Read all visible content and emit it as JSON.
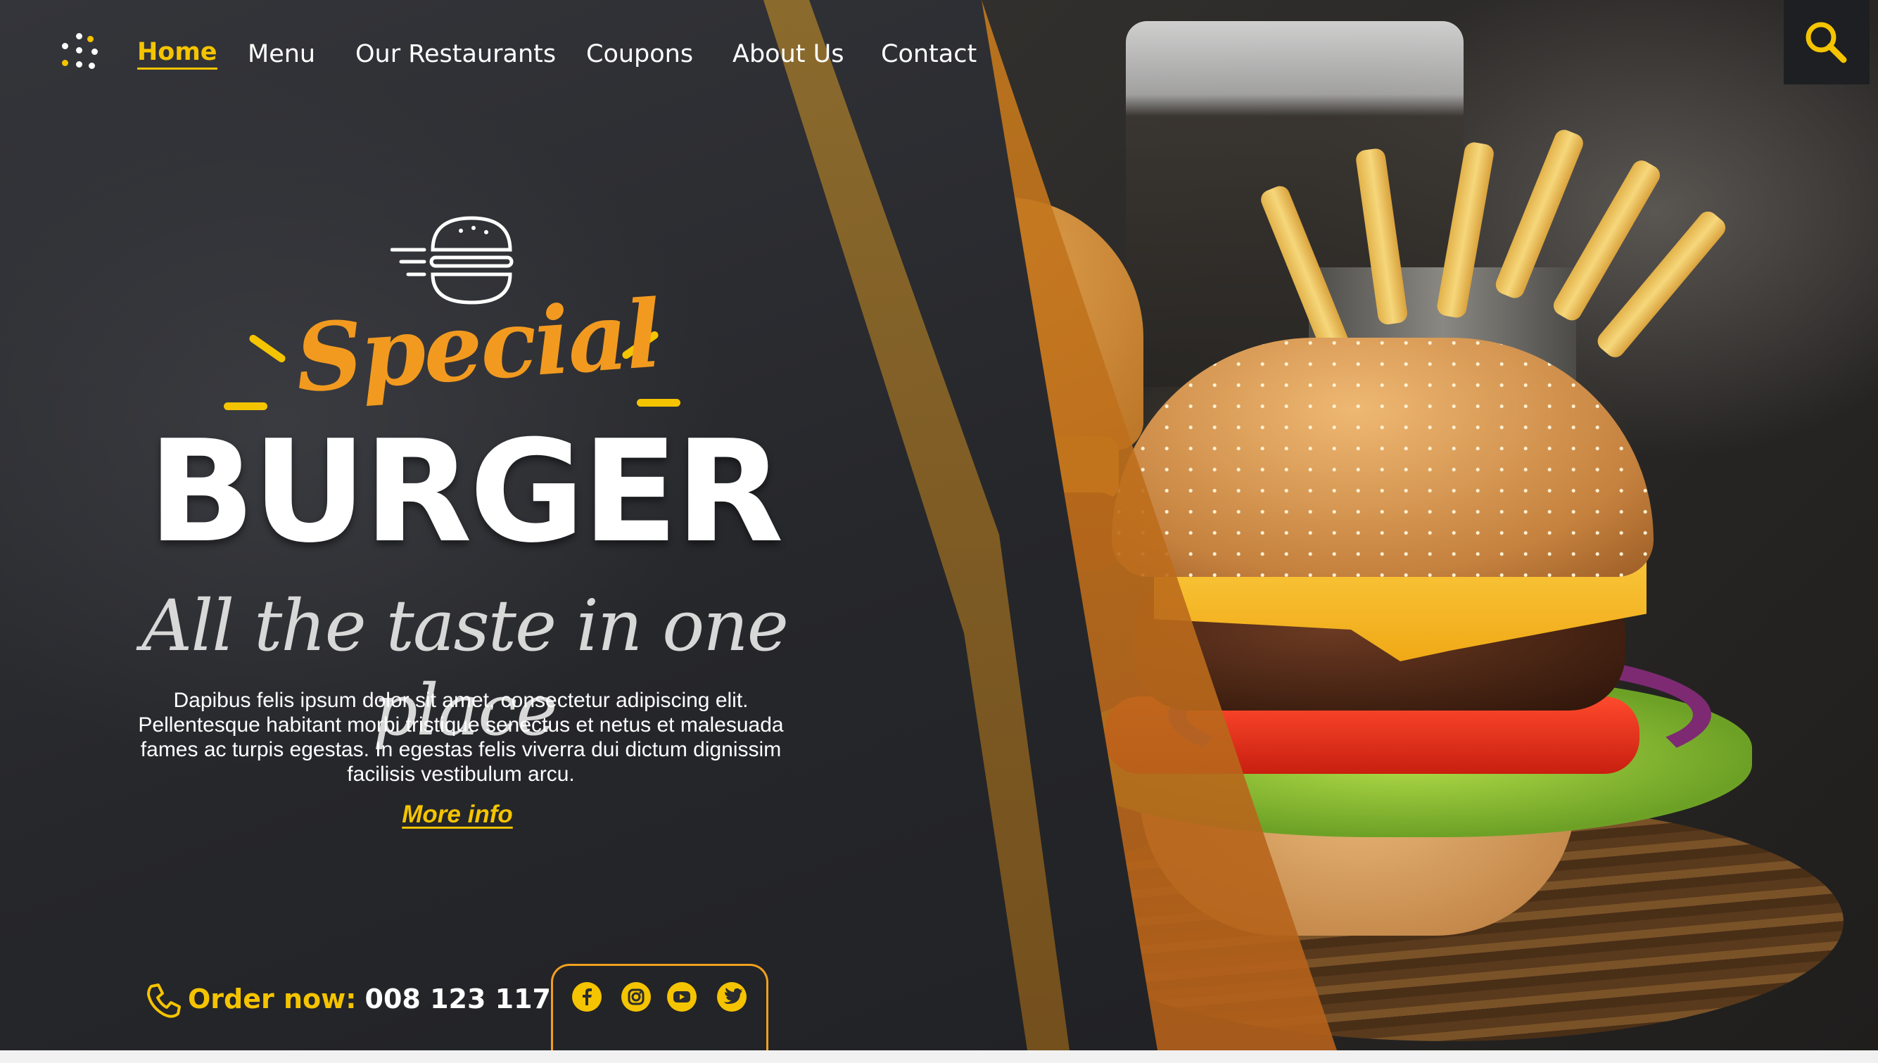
{
  "nav": {
    "items": [
      {
        "label": "Home",
        "active": true
      },
      {
        "label": "Menu",
        "active": false
      },
      {
        "label": "Our Restaurants",
        "active": false
      },
      {
        "label": "Coupons",
        "active": false
      },
      {
        "label": "About Us",
        "active": false
      },
      {
        "label": "Contact",
        "active": false
      }
    ],
    "menu_icon": "dots-grid-icon",
    "search_icon": "search-icon"
  },
  "hero": {
    "logo_icon": "burger-icon",
    "special": "Special",
    "title": "BURGER",
    "tagline": "All the taste in one place",
    "description": "Dapibus felis ipsum dolor sit amet, consectetur adipiscing elit. Pellentesque habitant morbi tristique senectus et netus et malesuada fames ac turpis egestas. In egestas felis viverra dui dictum dignissim facilisis vestibulum arcu.",
    "more_info": "More info"
  },
  "footer": {
    "order_label": "Order now:",
    "phone_number": "008 123 117",
    "social": [
      "facebook-icon",
      "instagram-icon",
      "youtube-icon",
      "twitter-icon"
    ]
  },
  "colors": {
    "accent_yellow": "#f5c400",
    "accent_orange": "#f29a1f",
    "panel_dark": "#2b2c30"
  }
}
